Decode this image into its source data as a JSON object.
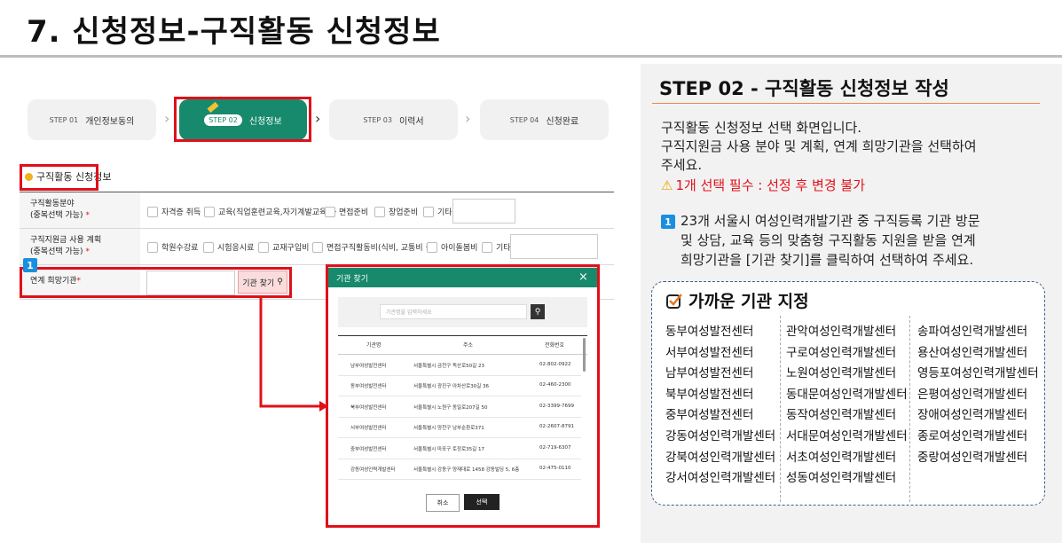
{
  "slide": {
    "title": "7. 신청정보-구직활동 신청정보"
  },
  "steps": [
    {
      "tag": "STEP 01",
      "label": "개인정보동의"
    },
    {
      "tag": "STEP 02",
      "label": "신청정보"
    },
    {
      "tag": "STEP 03",
      "label": "이력서"
    },
    {
      "tag": "STEP 04",
      "label": "신청완료"
    }
  ],
  "form": {
    "section_title": "구직활동 신청정보",
    "row1": {
      "label": "구직활동분야",
      "sub": "(중복선택 가능)",
      "options": [
        "자격증 취득",
        "교육(직업훈련교육,자기계발교육 등",
        "면접준비",
        "창업준비",
        "기타"
      ]
    },
    "row2": {
      "label": "구직지원금 사용 계획",
      "sub": "(중복선택 가능)",
      "options": [
        "학원수강료",
        "시험응시료",
        "교재구입비",
        "면접구직활동비(식비, 교통비 등)",
        "아이돌봄비",
        "기타"
      ]
    },
    "row3": {
      "label": "연계 희망기관",
      "button": "기관 찾기"
    },
    "req_mark": "*",
    "badge": "1"
  },
  "modal": {
    "title": "기관 찾기",
    "close": "×",
    "search_placeholder": "기관명을 입력하세요",
    "headers": [
      "기관명",
      "주소",
      "전화번호"
    ],
    "rows": [
      [
        "남부여성발전센터",
        "서울특별시 금천구 독산로50길 23",
        "02-802-0922"
      ],
      [
        "동부여성발전센터",
        "서울특별시 광진구 아차산로30길 36",
        "02-460-2300"
      ],
      [
        "북부여성발전센터",
        "서울특별시 노원구 동일로207길 50",
        "02-3399-7699"
      ],
      [
        "서부여성발전센터",
        "서울특별시 양천구 남부순환로371",
        "02-2607-8791"
      ],
      [
        "중부여성발전센터",
        "서울특별시 마포구 토정로35길 17",
        "02-719-6307"
      ],
      [
        "강동여성인력개발센터",
        "서울특별시 강동구 양재대로 1458 강동빌딩 5, 6층",
        "02-475-0110"
      ]
    ],
    "cancel": "취소",
    "select": "선택"
  },
  "panel": {
    "title": "STEP 02 - 구직활동 신청정보 작성",
    "desc1": "구직활동 신청정보 선택 화면입니다.",
    "desc2": "구직지원금 사용 분야 및 계획, 연계 희망기관을 선택하여",
    "desc3": "주세요.",
    "warn_icon": "⚠",
    "warning": "1개 선택 필수 : 선정 후 변경 불가",
    "note_badge": "1",
    "note1": "23개 서울시 여성인력개발기관 중 구직등록 기관 방문",
    "note2": "및 상담, 교육 등의 맞춤형 구직활동 지원을 받을 연계",
    "note3": "희망기관을 [기관 찾기]를 클릭하여 선택하여 주세요.",
    "near_title": "가까운 기관 지정",
    "centers_col1": [
      "동부여성발전센터",
      "서부여성발전센터",
      "남부여성발전센터",
      "북부여성발전센터",
      "중부여성발전센터",
      "강동여성인력개발센터",
      "강북여성인력개발센터",
      "강서여성인력개발센터"
    ],
    "centers_col2": [
      "관악여성인력개발센터",
      "구로여성인력개발센터",
      "노원여성인력개발센터",
      "동대문여성인력개발센터",
      "동작여성인력개발센터",
      "서대문여성인력개발센터",
      "서초여성인력개발센터",
      "성동여성인력개발센터"
    ],
    "centers_col3": [
      "송파여성인력개발센터",
      "용산여성인력개발센터",
      "영등포여성인력개발센터",
      "은평여성인력개발센터",
      "장애여성인력개발센터",
      "종로여성인력개발센터",
      "중랑여성인력개발센터"
    ]
  },
  "colors": {
    "accent": "#17896c",
    "highlight": "#e0101a",
    "badge": "#1a8fe0"
  }
}
